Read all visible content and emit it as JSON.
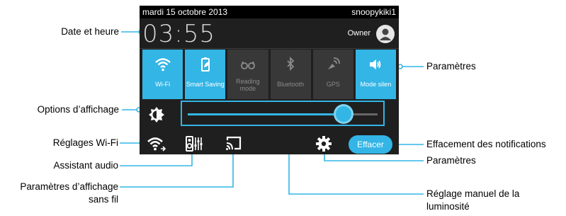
{
  "statusbar": {
    "date": "mardi 15 octobre 2013",
    "user": "snoopykiki1"
  },
  "header": {
    "clock": "03:55",
    "owner": "Owner"
  },
  "tiles": [
    {
      "label": "Wi-Fi",
      "icon": "wifi-icon",
      "state": "on"
    },
    {
      "label": "Smart Saving",
      "icon": "battery-leaf-icon",
      "state": "on"
    },
    {
      "label": "Reading mode",
      "icon": "glasses-icon",
      "state": "off"
    },
    {
      "label": "Bluetooth",
      "icon": "bluetooth-icon",
      "state": "off"
    },
    {
      "label": "GPS",
      "icon": "gps-icon",
      "state": "off"
    },
    {
      "label": "Mode silen",
      "icon": "sound-icon",
      "state": "on"
    }
  ],
  "brightness": {
    "level": 0.82
  },
  "bottom": {
    "clear_label": "Effacer"
  },
  "callouts": {
    "date_time": "Date et heure",
    "display_options": "Options d’affichage",
    "wifi_settings": "Réglages Wi-Fi",
    "audio_wizard": "Assistant audio",
    "wireless_display_1": "Paramètres d’affichage",
    "wireless_display_2": "sans fil",
    "settings_top": "Paramètres",
    "clear_notifications": "Effacement des notifications",
    "settings_bottom": "Paramètres",
    "brightness_1": "Réglage manuel de la",
    "brightness_2": "luminosité"
  },
  "colors": {
    "accent": "#33b5e5",
    "panel": "#1f1f1f",
    "tile_off": "#383838"
  }
}
